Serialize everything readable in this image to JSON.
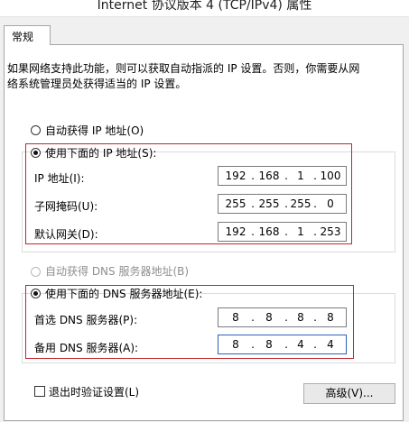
{
  "window": {
    "title": "Internet 协议版本 4 (TCP/IPv4) 属性"
  },
  "tab": {
    "label": "常规"
  },
  "intro_lines": [
    "如果网络支持此功能，则可以获取自动指派的 IP 设置。否则，你需要从网",
    "络系统管理员处获得适当的 IP 设置。"
  ],
  "ip": {
    "auto_label": "自动获得 IP 地址(O)",
    "manual_label": "使用下面的 IP 地址(S):",
    "address_label": "IP 地址(I):",
    "address": [
      "192",
      "168",
      "1",
      "100"
    ],
    "mask_label": "子网掩码(U):",
    "mask": [
      "255",
      "255",
      "255",
      "0"
    ],
    "gateway_label": "默认网关(D):",
    "gateway": [
      "192",
      "168",
      "1",
      "253"
    ]
  },
  "dns": {
    "auto_label": "自动获得 DNS 服务器地址(B)",
    "manual_label": "使用下面的 DNS 服务器地址(E):",
    "preferred_label": "首选 DNS 服务器(P):",
    "preferred": [
      "8",
      "8",
      "8",
      "8"
    ],
    "alternate_label": "备用 DNS 服务器(A):",
    "alternate": [
      "8",
      "8",
      "4",
      "4"
    ]
  },
  "footer": {
    "validate_label": "退出时验证设置(L)",
    "advanced_label": "高级(V)..."
  },
  "colors": {
    "highlight": "#c0272d"
  }
}
